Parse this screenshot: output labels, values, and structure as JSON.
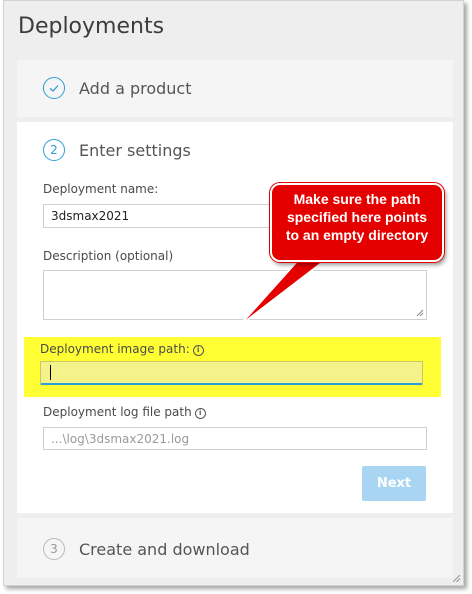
{
  "page": {
    "title": "Deployments"
  },
  "steps": [
    {
      "number": "✓",
      "label": "Add a product",
      "state": "completed"
    },
    {
      "number": "2",
      "label": "Enter settings",
      "state": "active"
    },
    {
      "number": "3",
      "label": "Create and download",
      "state": "pending"
    }
  ],
  "form": {
    "deployment_name": {
      "label": "Deployment name:",
      "value": "3dsmax2021"
    },
    "description": {
      "label": "Description (optional)",
      "value": ""
    },
    "image_path": {
      "label": "Deployment image path:",
      "value": ""
    },
    "log_path": {
      "label": "Deployment log file path",
      "placeholder": "...\\log\\3dsmax2021.log"
    },
    "next_label": "Next"
  },
  "annotation": {
    "text_lines": [
      "Make sure the path",
      "specified here points",
      "to an empty directory"
    ]
  },
  "colors": {
    "accent": "#2a9fd8",
    "highlight": "#ffff33",
    "callout": "#e50000",
    "next_disabled": "#a8d5f2"
  }
}
